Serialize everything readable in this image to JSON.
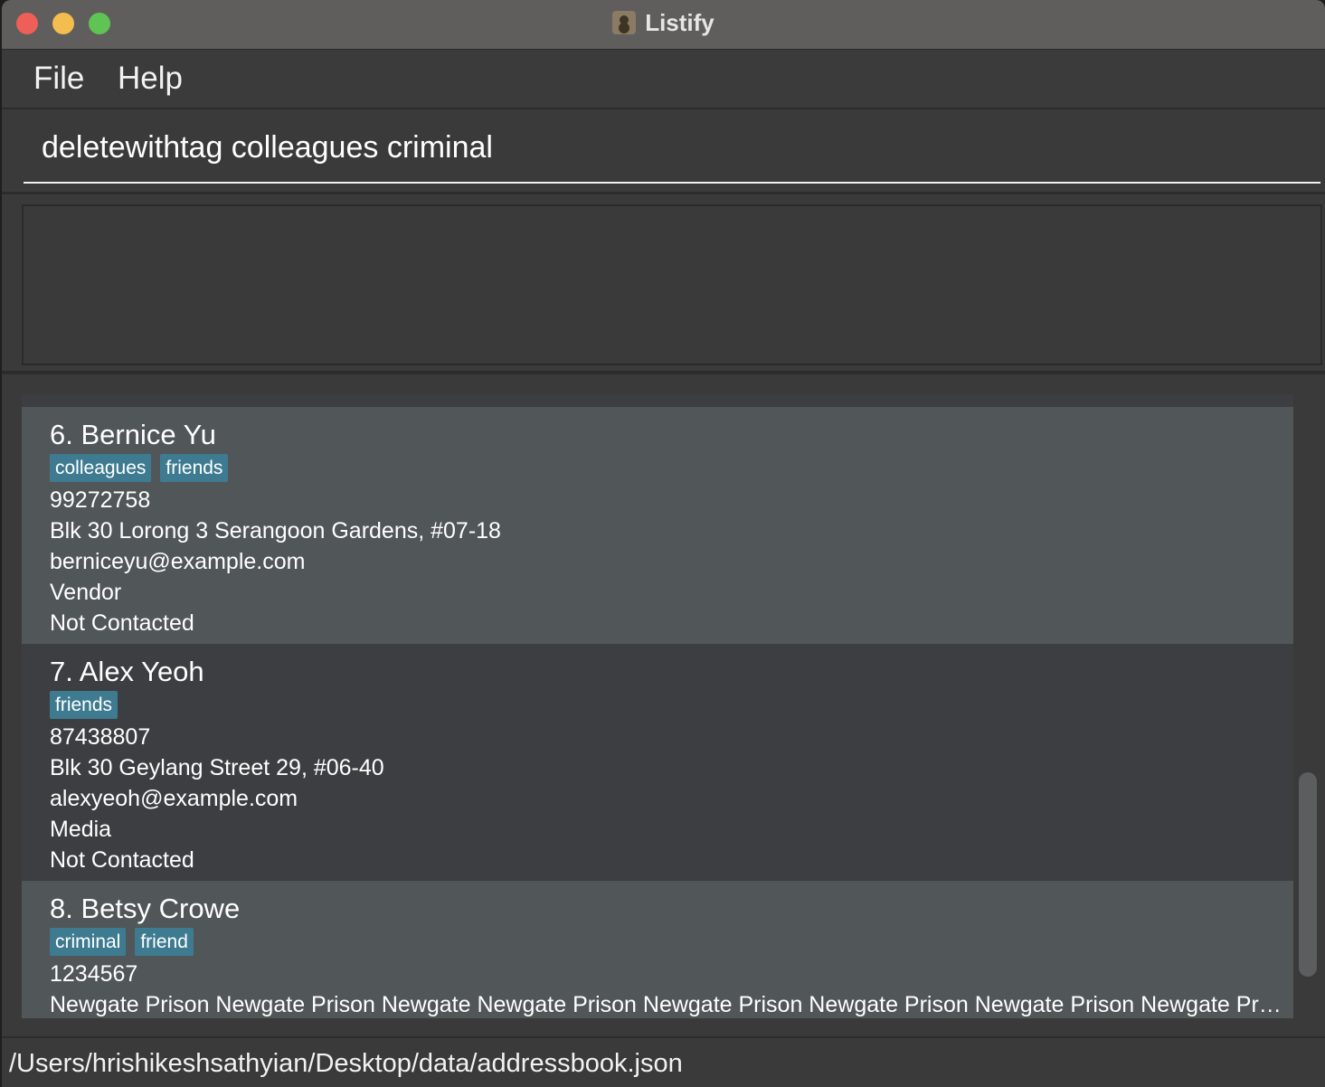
{
  "window": {
    "title": "Listify"
  },
  "menu": {
    "file": "File",
    "help": "Help"
  },
  "command": {
    "value": "deletewithtag colleagues criminal"
  },
  "result": {
    "text": ""
  },
  "persons": [
    {
      "name": "6. Bernice Yu",
      "tags": [
        "colleagues",
        "friends"
      ],
      "phone": "99272758",
      "address": "Blk 30 Lorong 3 Serangoon Gardens, #07-18",
      "email": "berniceyu@example.com",
      "role": "Vendor",
      "status": "Not Contacted"
    },
    {
      "name": "7. Alex Yeoh",
      "tags": [
        "friends"
      ],
      "phone": "87438807",
      "address": "Blk 30 Geylang Street 29, #06-40",
      "email": "alexyeoh@example.com",
      "role": "Media",
      "status": "Not Contacted"
    },
    {
      "name": "8. Betsy Crowe",
      "tags": [
        "criminal",
        "friend"
      ],
      "phone": "1234567",
      "address": "Newgate Prison Newgate Prison  Newgate Newgate Prison Newgate Prison Newgate Prison Newgate Prison Newgate Prison..."
    }
  ],
  "status": {
    "path": "/Users/hrishikeshsathyian/Desktop/data/addressbook.json"
  },
  "colors": {
    "tag": "#3e7b91",
    "card_odd": "#515659",
    "card_even": "#3c3e41",
    "close": "#ed5f57",
    "minimize": "#f4bd4f",
    "maximize": "#5fc454"
  }
}
